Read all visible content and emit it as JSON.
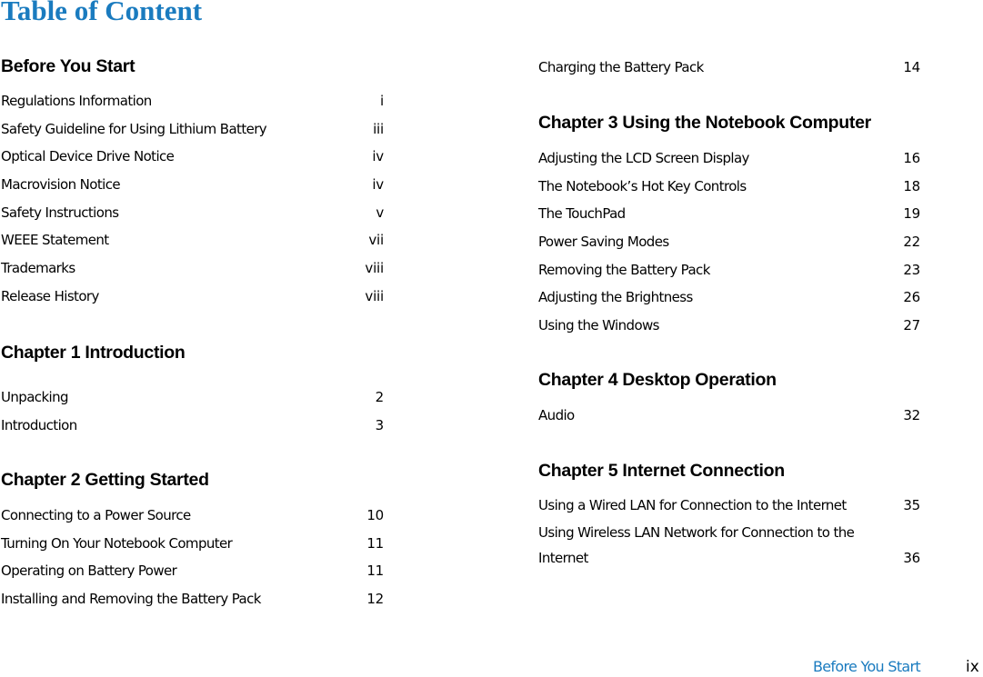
{
  "title": "Table of Content",
  "sections": [
    {
      "heading": "Before You Start",
      "entries": [
        {
          "label": "Regulations Information",
          "page": "i"
        },
        {
          "label": "Safety Guideline for Using Lithium Battery",
          "page": "iii"
        },
        {
          "label": "Optical Device Drive Notice",
          "page": "iv"
        },
        {
          "label": "Macrovision Notice",
          "page": "iv"
        },
        {
          "label": "Safety Instructions",
          "page": "v"
        },
        {
          "label": "WEEE Statement",
          "page": "vii"
        },
        {
          "label": "Trademarks",
          "page": "viii"
        },
        {
          "label": "Release History",
          "page": "viii"
        }
      ]
    },
    {
      "heading": "Chapter 1  Introduction",
      "entries": [
        {
          "label": "Unpacking",
          "page": "2"
        },
        {
          "label": "Introduction",
          "page": "3"
        }
      ]
    },
    {
      "heading": "Chapter 2  Getting Started",
      "entries": [
        {
          "label": "Connecting to a Power Source",
          "page": "10"
        },
        {
          "label": "Turning On Your Notebook Computer",
          "page": "11"
        },
        {
          "label": "Operating on Battery Power",
          "page": "11"
        },
        {
          "label": "Installing and Removing the Battery Pack",
          "page": "12"
        },
        {
          "label": "Charging the Battery Pack",
          "page": "14"
        }
      ]
    },
    {
      "heading": "Chapter 3  Using the Notebook Computer",
      "entries": [
        {
          "label": "Adjusting the LCD Screen Display",
          "page": "16"
        },
        {
          "label": "The Notebook’s Hot Key Controls",
          "page": "18"
        },
        {
          "label": "The TouchPad",
          "page": "19"
        },
        {
          "label": "Power Saving Modes",
          "page": "22"
        },
        {
          "label": "Removing the Battery Pack",
          "page": "23"
        },
        {
          "label": "Adjusting the Brightness",
          "page": "26"
        },
        {
          "label": "Using the Windows",
          "page": "27"
        }
      ]
    },
    {
      "heading": "Chapter 4  Desktop Operation",
      "entries": [
        {
          "label": "Audio",
          "page": "32"
        }
      ]
    },
    {
      "heading": "Chapter 5  Internet Connection",
      "entries": [
        {
          "label": "Using a Wired LAN for Connection to the Internet",
          "page": "35"
        },
        {
          "label": "Using Wireless LAN Network for Connection to the Internet",
          "page": "36"
        }
      ]
    }
  ],
  "footer": {
    "section": "Before You Start",
    "page": "ix"
  },
  "colors": {
    "accent": "#1a7bbf",
    "text": "#000000"
  }
}
